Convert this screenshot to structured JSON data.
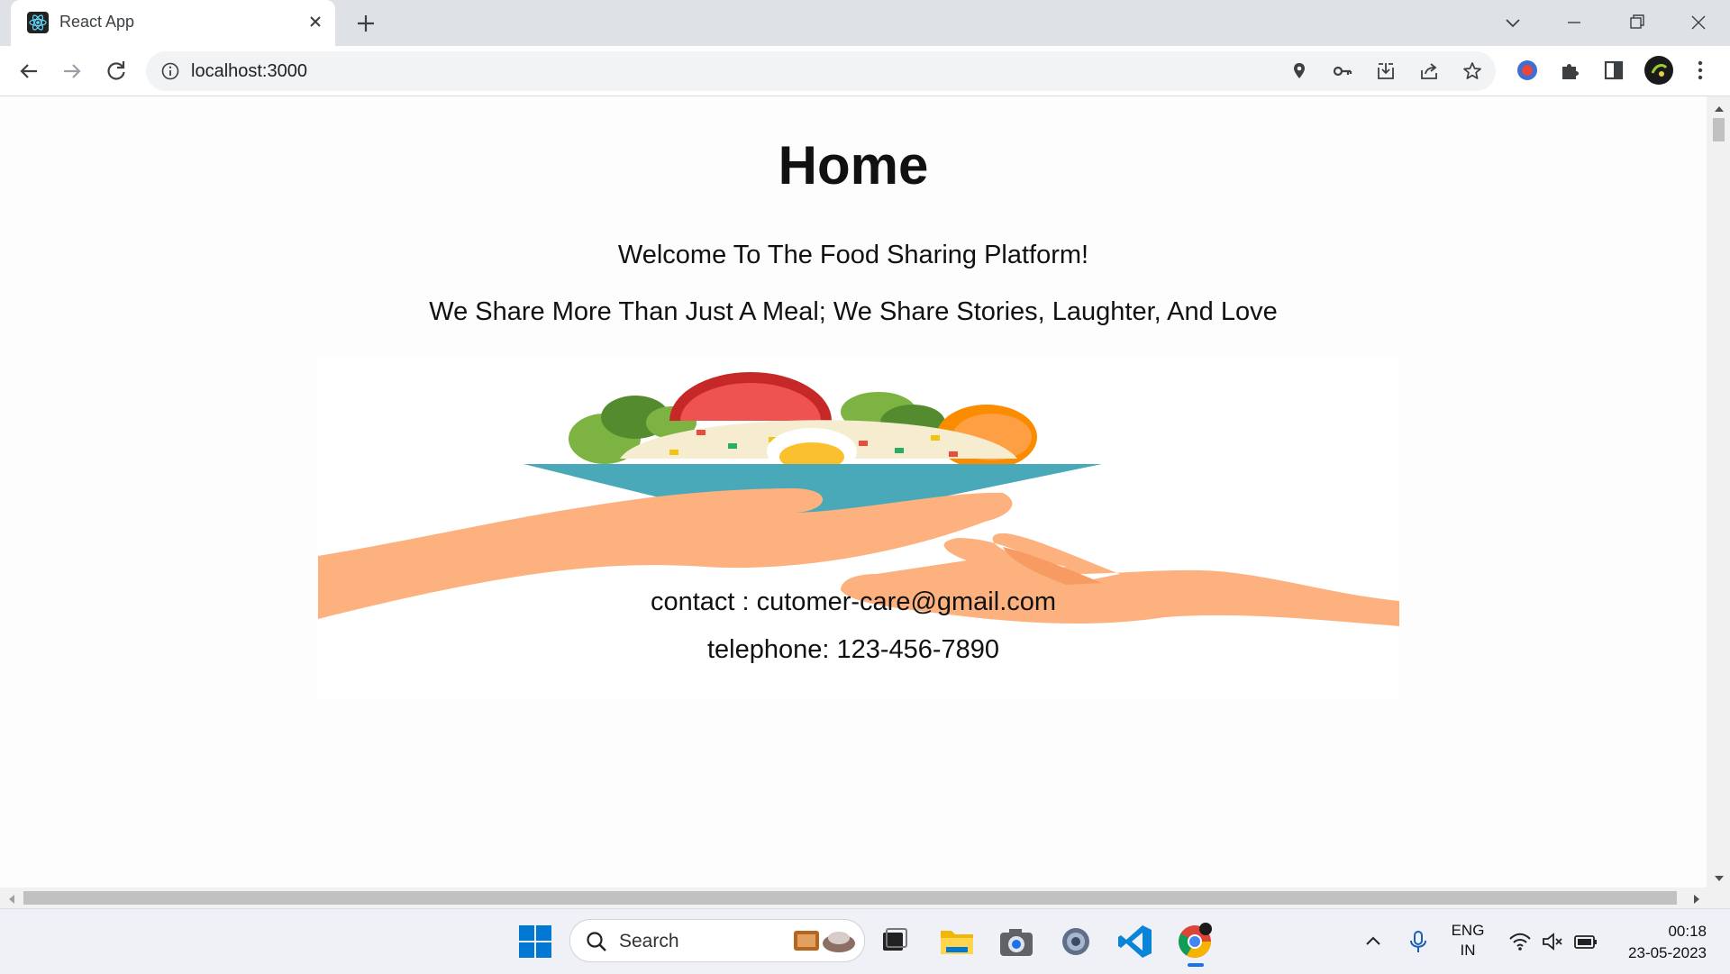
{
  "browser": {
    "tab_title": "React App",
    "url": "localhost:3000"
  },
  "page": {
    "title": "Home",
    "welcome": "Welcome To The Food Sharing Platform!",
    "tagline": "We Share More Than Just A Meal; We Share Stories, Laughter, And Love",
    "contact": "contact : cutomer-care@gmail.com",
    "telephone": "telephone: 123-456-7890"
  },
  "taskbar": {
    "search_label": "Search",
    "language_top": "ENG",
    "language_bottom": "IN",
    "time": "00:18",
    "date": "23-05-2023"
  },
  "colors": {
    "bowl": "#4aa9b8",
    "hand": "#fdb17e",
    "accent_blue": "#1a73e8"
  }
}
